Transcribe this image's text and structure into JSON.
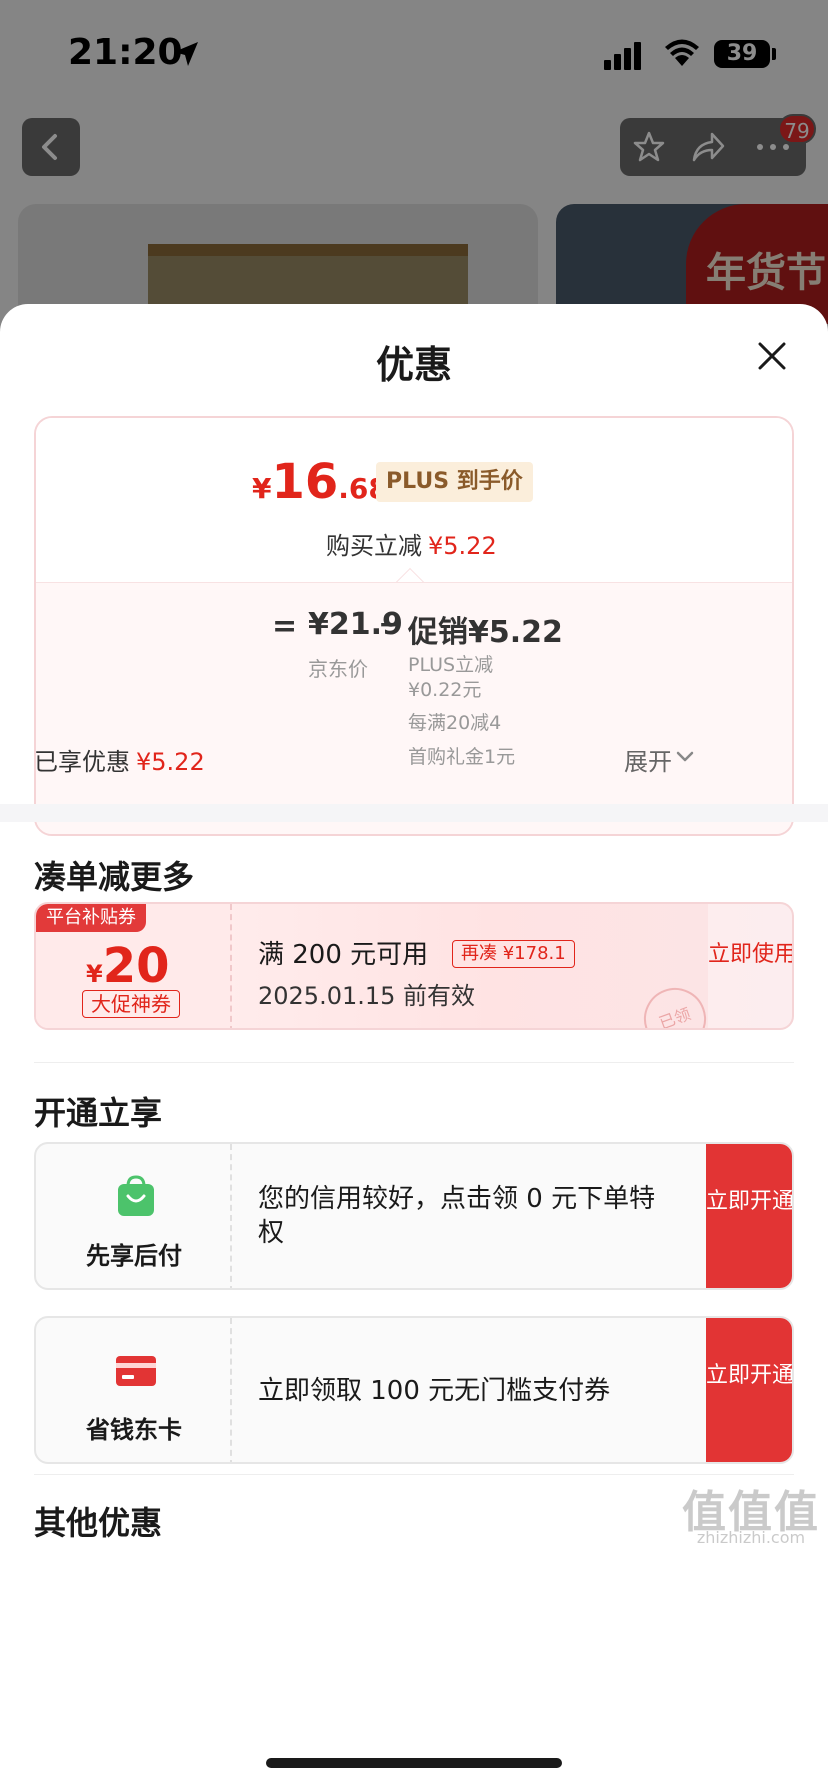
{
  "status_bar": {
    "time": "21:20",
    "battery": "39"
  },
  "nav": {
    "badge_count": "79"
  },
  "background": {
    "banner_text": "年货节"
  },
  "sheet": {
    "title": "优惠",
    "price": {
      "currency": "¥",
      "integer": "16",
      "decimal": ".68",
      "plus_tag": "PLUS 到手价",
      "buy_reduce_label": "购买立减",
      "buy_reduce_amount": "¥5.22"
    },
    "breakdown": {
      "equals": "=",
      "jd_price": "¥21.9",
      "jd_price_label": "京东价",
      "minus": "−",
      "promo": "促销¥5.22",
      "promo_items": [
        "PLUS立减¥0.22元",
        "每满20减4",
        "首购礼金1元"
      ]
    },
    "enjoyed_label": "已享优惠",
    "enjoyed_amount": "¥5.22",
    "expand_label": "展开"
  },
  "more_section": {
    "title": "凑单减更多",
    "coupon": {
      "platform_tag": "平台补贴券",
      "currency": "¥",
      "amount": "20",
      "type": "大促神券",
      "condition": "满 200 元可用",
      "more": "再凑 ¥178.1",
      "valid": "2025.01.15 前有效",
      "stamp": "已领",
      "button": "立即使用"
    }
  },
  "open_section": {
    "title": "开通立享",
    "cards": [
      {
        "name": "先享后付",
        "desc": "您的信用较好，点击领 0 元下单特权",
        "button": "立即开通",
        "icon": "shopping-bag-icon",
        "color": "#4cc36b"
      },
      {
        "name": "省钱东卡",
        "desc": "立即领取 100 元无门槛支付券",
        "button": "立即开通",
        "icon": "card-icon",
        "color": "#e23434"
      }
    ]
  },
  "other_section": {
    "title": "其他优惠"
  },
  "watermark": {
    "main": "值值值",
    "sub": "zhizhizhi.com"
  },
  "colors": {
    "accent_red": "#e1251b",
    "button_red": "#e23434"
  }
}
